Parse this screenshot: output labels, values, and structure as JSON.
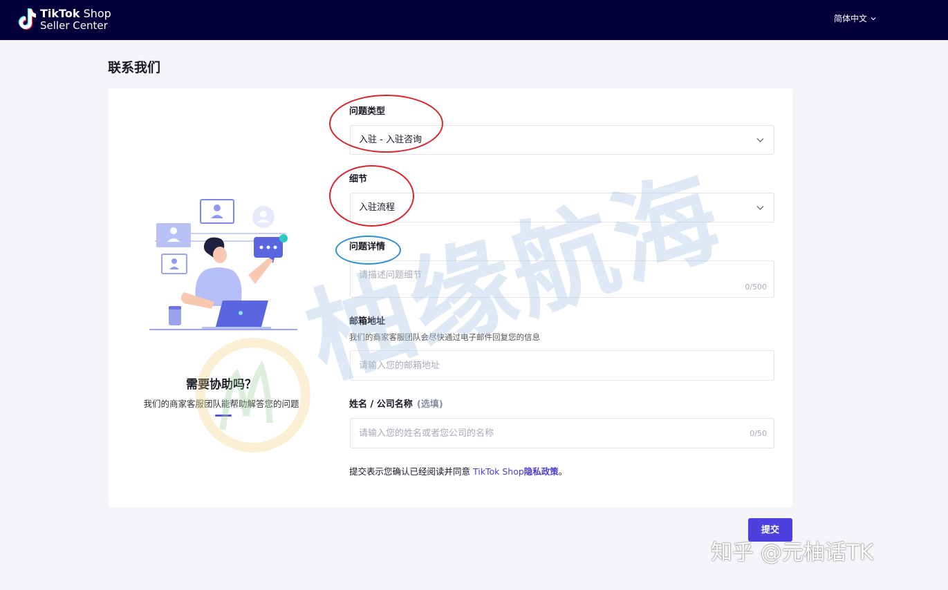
{
  "header": {
    "logo_line1_bold": "TikTok",
    "logo_line1_rest": "Shop",
    "logo_line2": "Seller Center",
    "language": "简体中文"
  },
  "page": {
    "title": "联系我们"
  },
  "help": {
    "title": "需要协助吗？",
    "subtitle": "我们的商家客服团队能帮助解答您的问题"
  },
  "form": {
    "issue_type": {
      "label": "问题类型",
      "value": "入驻 - 入驻咨询"
    },
    "detail": {
      "label": "细节",
      "value": "入驻流程"
    },
    "description": {
      "label": "问题详情",
      "placeholder": "请描述问题细节",
      "counter": "0/500"
    },
    "email": {
      "label": "邮箱地址",
      "hint": "我们的商家客服团队会尽快通过电子邮件回复您的信息",
      "placeholder": "请输入您的邮箱地址"
    },
    "name": {
      "label": "姓名 / 公司名称",
      "optional": "(选填)",
      "placeholder": "请输入您的姓名或者您公司的名称",
      "counter": "0/50"
    },
    "agreement": {
      "prefix": "提交表示您确认已经阅读并同意",
      "link_brand": "TikTok Shop",
      "link_policy": "隐私政策",
      "suffix": "。"
    },
    "submit_label": "提交"
  },
  "watermarks": {
    "diagonal": "柚缘航海",
    "corner": "知乎 @元柚话TK"
  },
  "icons": [
    "tiktok-logo-icon",
    "chevron-down-icon",
    "support-illustration"
  ],
  "colors": {
    "topbar": "#05003a",
    "accent": "#4e3fdf",
    "annotation_red": "#d8242c",
    "annotation_blue": "#2c8fd8"
  }
}
